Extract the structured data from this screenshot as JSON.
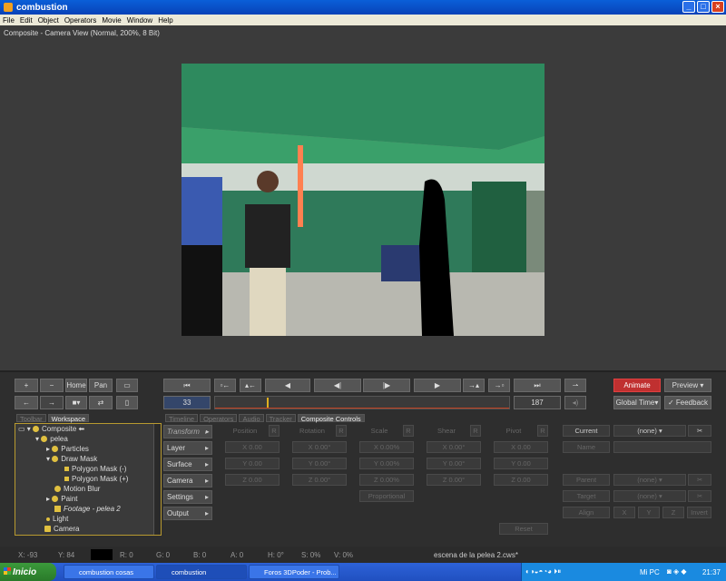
{
  "window": {
    "title": "combustion"
  },
  "menu": [
    "File",
    "Edit",
    "Object",
    "Operators",
    "Movie",
    "Window",
    "Help"
  ],
  "viewer": {
    "label": "Composite - Camera View (Normal, 200%, 8 Bit)"
  },
  "nav": {
    "home": "Home",
    "pan": "Pan"
  },
  "transport": {
    "current_frame": "33",
    "end_frame": "187"
  },
  "right": {
    "animate": "Animate",
    "preview": "Preview",
    "global_time": "Global Time",
    "feedback": "Feedback"
  },
  "left_tabs": [
    "Toolbar",
    "Workspace"
  ],
  "center_tabs": [
    "Timeline",
    "Operators",
    "Audio",
    "Tracker",
    "Composite Controls"
  ],
  "tree": [
    "Composite",
    "pelea",
    "Particles",
    "Draw Mask",
    "Polygon Mask (-)",
    "Polygon Mask (+)",
    "Motion Blur",
    "Paint",
    "Footage - pelea 2",
    "Light",
    "Camera"
  ],
  "side_buttons": [
    "Transform",
    "Layer",
    "Surface",
    "Camera",
    "Settings",
    "Output"
  ],
  "groups": {
    "position": {
      "label": "Position",
      "x": "X 0.00",
      "y": "Y 0.00",
      "z": "Z 0.00"
    },
    "rotation": {
      "label": "Rotation",
      "x": "X 0.00°",
      "y": "Y 0.00°",
      "z": "Z 0.00°"
    },
    "scale": {
      "label": "Scale",
      "x": "X 0.00%",
      "y": "Y 0.00%",
      "z": "Z 0.00%"
    },
    "shear": {
      "label": "Shear",
      "x": "X 0.00°",
      "y": "Y 0.00°",
      "z": "Z 0.00°"
    },
    "pivot": {
      "label": "Pivot",
      "x": "X 0.00",
      "y": "Y 0.00",
      "z": "Z 0.00"
    },
    "proportional": "Proportional",
    "reset": "Reset",
    "lock": "R"
  },
  "object": {
    "current": "Current",
    "current_value": "(none)",
    "name": "Name",
    "parent": "Parent",
    "parent_value": "(none)",
    "target": "Target",
    "target_value": "(none)",
    "align": "Align",
    "align_x": "X",
    "align_y": "Y",
    "align_z": "Z",
    "invert": "Invert"
  },
  "status": {
    "x": "X: -93",
    "y": "Y: 84",
    "r": "R: 0",
    "g": "G: 0",
    "b": "B: 0",
    "a": "A: 0",
    "h": "H: 0°",
    "s": "S: 0%",
    "v": "V: 0%",
    "file": "escena de la pelea 2.cws*"
  },
  "taskbar": {
    "start": "Inicio",
    "tasks": [
      "combustion cosas",
      "combustion",
      "Foros 3DPoder - Prob..."
    ],
    "tray_label": "Mi PC",
    "clock": "21:37"
  }
}
